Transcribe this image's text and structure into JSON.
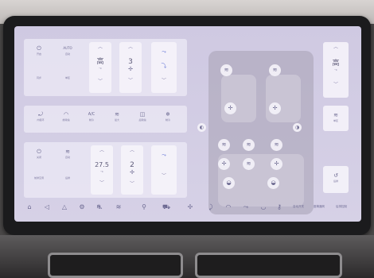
{
  "status_bar": {
    "left_text": "",
    "center_text": "",
    "items": [
      "",
      "",
      "",
      "",
      "",
      ""
    ]
  },
  "left_panel": {
    "row1": {
      "btn_a": {
        "icon": "power-icon",
        "glyph": "⏻",
        "label": "开启"
      },
      "btn_b": {
        "icon": "auto-icon",
        "glyph": "AUTO",
        "label": "自动"
      },
      "btn_c": {
        "label": "同步"
      },
      "btn_d": {
        "label": "单区"
      },
      "temp": {
        "value": "高",
        "unit": "°C"
      },
      "fan": {
        "value": "3",
        "glyph": "✢"
      },
      "wind": {
        "glyph": "⤳"
      }
    },
    "row2": {
      "items": [
        {
          "icon": "car-recirc-icon",
          "glyph": "⤾",
          "label": "内循环"
        },
        {
          "icon": "windshield-icon",
          "glyph": "◠",
          "label": "前除霜"
        },
        {
          "icon": "ac-icon",
          "glyph": "A/C",
          "label": "制冷"
        },
        {
          "icon": "max-icon",
          "glyph": "≋",
          "label": "最大"
        },
        {
          "icon": "rear-defrost-icon",
          "glyph": "◫",
          "label": "后除霜"
        },
        {
          "icon": "snowflake-icon",
          "glyph": "❄",
          "label": "制冷"
        }
      ]
    },
    "row3": {
      "btn_a": {
        "glyph": "⏻",
        "label": "关闭"
      },
      "btn_b": {
        "glyph": "≋",
        "label": "自动"
      },
      "btn_c": {
        "label": "前排空调"
      },
      "btn_d": {
        "label": "后排"
      },
      "temp": {
        "value": "27.5",
        "unit": "°C"
      },
      "fan": {
        "value": "2",
        "glyph": "✢"
      }
    }
  },
  "car_panel": {
    "icons": [
      "≋",
      "≋",
      "✢",
      "✢",
      "≋",
      "≋",
      "≋",
      "✢",
      "≋",
      "✢",
      "◒",
      "◒"
    ],
    "side_left": "◐",
    "side_right": "◑"
  },
  "right_panel": {
    "temp": {
      "value": "高",
      "unit": "°C"
    },
    "mid": {
      "glyph": "≋",
      "label": "单区"
    },
    "bottom": {
      "glyph": "↺",
      "label": "后排"
    }
  },
  "nav_bar": {
    "items": [
      "⌂",
      "◁",
      "△",
      "⚙",
      "⛐",
      "≋",
      "⚲",
      "⛟",
      "✢",
      "⤸",
      "◠",
      "⤳",
      "◡",
      "⚷"
    ],
    "texts": [
      "自动开关",
      "座椅通风",
      "后排控制"
    ]
  }
}
